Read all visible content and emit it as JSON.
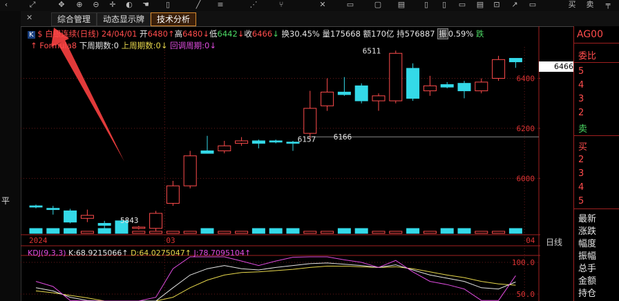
{
  "toolbar": {
    "icons": [
      "chevron-icon",
      "zoom-icon",
      "move-icon",
      "zoom-in-icon",
      "zoom-out-icon",
      "crosshair-icon",
      "palette-icon",
      "hand-icon",
      "line-icon",
      "ray-icon",
      "fork-icon",
      "rect-icon",
      "text-icon",
      "tool-icon",
      "save-icon",
      "copy-icon",
      "arrow-icon",
      "window-icon",
      "buy-icon",
      "sell-icon",
      "flat-icon"
    ],
    "buy": "买",
    "sell": "卖",
    "flat": "平"
  },
  "tabs": [
    {
      "label": "综合管理"
    },
    {
      "label": "动态显示牌"
    },
    {
      "label": "技术分析"
    }
  ],
  "info": {
    "badge": "K",
    "name": "白银连续(日线)",
    "date": "24/04/01",
    "open_label": "开",
    "open": "6480",
    "high_label": "高",
    "high": "6480",
    "low_label": "低",
    "low": "6442",
    "close_label": "收",
    "close": "6466",
    "turnover_label": "换",
    "turnover": "30.45%",
    "volume_label": "量",
    "volume": "175668",
    "amount_label": "额",
    "amount": "170亿",
    "hold_label": "持",
    "hold": "576887",
    "amp_label": "振",
    "amp": "0.59%",
    "fall_label": "跌"
  },
  "formula": {
    "name": "Formula8",
    "down_label": "下周期数:",
    "down": "0",
    "up_label": "上周期数:",
    "up": "0",
    "pull_label": "回调周期:",
    "pull": "0"
  },
  "kdj": {
    "name": "KDJ(9,3,3)",
    "k_label": "K:",
    "k": "68.9215066",
    "d_label": "D:",
    "d": "64.0275047",
    "j_label": "J:",
    "j": "78.7095104"
  },
  "right_panel": {
    "code": "AG00",
    "weibi": "委比",
    "sell_nums": [
      "5",
      "4",
      "3",
      "2"
    ],
    "sell_label": "卖",
    "buy_label": "买",
    "buy_nums": [
      "2",
      "3",
      "4",
      "5"
    ],
    "stats": [
      "最新",
      "涨跌",
      "幅度",
      "振幅",
      "总手",
      "金额",
      "持仓"
    ]
  },
  "price_tag": "6466",
  "day_label": "日线",
  "chart_data": {
    "type": "candlestick",
    "y_ticks": [
      6000,
      6200,
      6400
    ],
    "kdj_ticks": [
      "100.0",
      "50.0"
    ],
    "x_labels": [
      {
        "label": "2024",
        "index": 0
      },
      {
        "label": "03",
        "index": 8
      },
      {
        "label": "04",
        "index": 29
      }
    ],
    "candles": [
      {
        "o": 5890,
        "h": 5895,
        "l": 5880,
        "c": 5885
      },
      {
        "o": 5880,
        "h": 5890,
        "l": 5855,
        "c": 5875
      },
      {
        "o": 5870,
        "h": 5878,
        "l": 5820,
        "c": 5825
      },
      {
        "o": 5840,
        "h": 5875,
        "l": 5825,
        "c": 5852
      },
      {
        "o": 5820,
        "h": 5830,
        "l": 5800,
        "c": 5812
      },
      {
        "o": 5830,
        "h": 5835,
        "l": 5790,
        "c": 5800
      },
      {
        "o": 5800,
        "h": 5810,
        "l": 5795,
        "c": 5805
      },
      {
        "o": 5800,
        "h": 5870,
        "l": 5790,
        "c": 5860
      },
      {
        "o": 5900,
        "h": 5990,
        "l": 5890,
        "c": 5970
      },
      {
        "o": 5970,
        "h": 6110,
        "l": 5960,
        "c": 6090
      },
      {
        "o": 6110,
        "h": 6170,
        "l": 6100,
        "c": 6100
      },
      {
        "o": 6110,
        "h": 6150,
        "l": 6100,
        "c": 6130
      },
      {
        "o": 6140,
        "h": 6165,
        "l": 6130,
        "c": 6150
      },
      {
        "o": 6150,
        "h": 6155,
        "l": 6120,
        "c": 6140
      },
      {
        "o": 6150,
        "h": 6155,
        "l": 6140,
        "c": 6145
      },
      {
        "o": 6145,
        "h": 6150,
        "l": 6110,
        "c": 6140
      },
      {
        "o": 6180,
        "h": 6350,
        "l": 6157,
        "c": 6280
      },
      {
        "o": 6290,
        "h": 6400,
        "l": 6270,
        "c": 6345
      },
      {
        "o": 6345,
        "h": 6405,
        "l": 6330,
        "c": 6335
      },
      {
        "o": 6370,
        "h": 6380,
        "l": 6300,
        "c": 6310
      },
      {
        "o": 6310,
        "h": 6340,
        "l": 6270,
        "c": 6330
      },
      {
        "o": 6310,
        "h": 6511,
        "l": 6300,
        "c": 6500
      },
      {
        "o": 6440,
        "h": 6460,
        "l": 6310,
        "c": 6320
      },
      {
        "o": 6350,
        "h": 6410,
        "l": 6330,
        "c": 6370
      },
      {
        "o": 6375,
        "h": 6385,
        "l": 6360,
        "c": 6365
      },
      {
        "o": 6380,
        "h": 6390,
        "l": 6320,
        "c": 6350
      },
      {
        "o": 6350,
        "h": 6400,
        "l": 6340,
        "c": 6385
      },
      {
        "o": 6400,
        "h": 6490,
        "l": 6390,
        "c": 6475
      },
      {
        "o": 6480,
        "h": 6480,
        "l": 6442,
        "c": 6466
      }
    ],
    "annotations": [
      {
        "text": "6511",
        "index": 21,
        "value": 6511
      },
      {
        "text": "6157",
        "index": 16,
        "value": 6157
      },
      {
        "text": "6166",
        "index": 16,
        "value": 6166
      },
      {
        "text": "5843",
        "index": 5,
        "value": 5843
      }
    ],
    "kdj_k": [
      60,
      55,
      45,
      40,
      30,
      25,
      20,
      35,
      60,
      80,
      90,
      95,
      90,
      88,
      92,
      95,
      98,
      99,
      97,
      95,
      92,
      96,
      88,
      80,
      75,
      70,
      60,
      58,
      69
    ],
    "kdj_d": [
      55,
      52,
      48,
      44,
      38,
      32,
      28,
      30,
      45,
      60,
      72,
      80,
      84,
      85,
      87,
      89,
      92,
      94,
      94,
      93,
      92,
      93,
      90,
      85,
      80,
      76,
      70,
      66,
      64
    ],
    "kdj_j": [
      70,
      62,
      40,
      32,
      15,
      10,
      5,
      45,
      90,
      110,
      120,
      120,
      102,
      95,
      102,
      108,
      110,
      110,
      104,
      100,
      92,
      103,
      85,
      70,
      65,
      58,
      40,
      40,
      79
    ]
  }
}
